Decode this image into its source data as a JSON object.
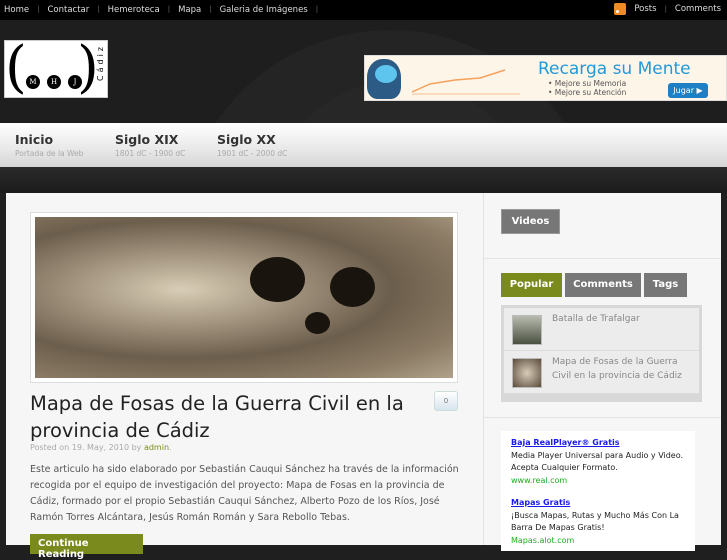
{
  "topbar": {
    "menu": [
      "Home",
      "Contactar",
      "Hemeroteca",
      "Mapa",
      "Galeria de Imágenes"
    ],
    "posts": "Posts",
    "comments": "Comments"
  },
  "logo": {
    "letters": [
      "M",
      "H",
      "J"
    ],
    "city": "Cádiz"
  },
  "ad": {
    "title": "Recarga su Mente",
    "bullets": [
      "• Mejore su Memoria",
      "• Mejore su Atención"
    ],
    "button": "Jugar ▶"
  },
  "nav": [
    {
      "title": "Inicio",
      "sub": "Portada de la Web"
    },
    {
      "title": "Siglo XIX",
      "sub": "1801 dC - 1900 dC"
    },
    {
      "title": "Siglo XX",
      "sub": "1901 dC - 2000 dC"
    }
  ],
  "post": {
    "title": "Mapa de Fosas de la Guerra Civil en la provincia de Cádiz",
    "comments": "0",
    "posted": "Posted on 19. May, 2010 by",
    "author": "admin",
    "excerpt": "Este articulo ha sido elaborado por Sebastián Cauqui Sánchez ha través de la información recogida por el equipo de investigación del proyecto: Mapa de Fosas en la provincia de Cádiz, formado por el propio Sebastián Cauqui Sánchez, Alberto Pozo de los Ríos, José Ramón Torres Alcántara, Jesús Román Román y Sara Rebollo Tebas.",
    "more": "Continue Reading"
  },
  "sidebar": {
    "videos": "Videos",
    "tabs": [
      "Popular",
      "Comments",
      "Tags"
    ],
    "popular": [
      "Batalla de Trafalgar",
      "Mapa de Fosas de la Guerra Civil en la provincia de Cádiz"
    ],
    "ads": [
      {
        "title": "Baja RealPlayer® Gratis",
        "text": "Media Player Universal para Audio y Video. Acepta Cualquier Formato.",
        "url": "www.real.com"
      },
      {
        "title": "Mapas Gratis",
        "text": "¡Busca Mapas, Rutas y Mucho Más Con La Barra De Mapas Gratis!",
        "url": "Mapas.alot.com"
      }
    ]
  },
  "colors": {
    "accent": "#7b8a1c"
  }
}
